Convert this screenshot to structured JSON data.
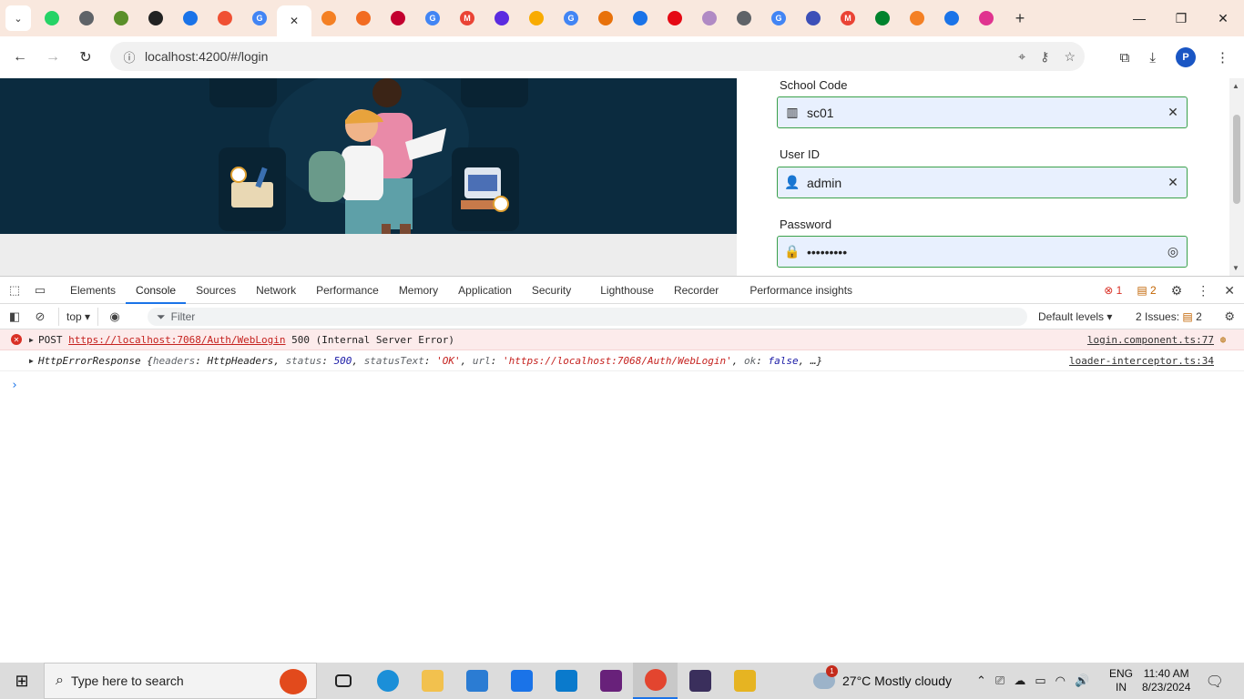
{
  "browser": {
    "tabs": [
      {
        "icon": "whatsapp-icon",
        "color": "#25d366",
        "glyph": ""
      },
      {
        "icon": "globe-icon",
        "color": "#5f6368",
        "glyph": ""
      },
      {
        "icon": "app-icon",
        "color": "#5a8f29",
        "glyph": ""
      },
      {
        "icon": "github-icon",
        "color": "#222222",
        "glyph": ""
      },
      {
        "icon": "chrome-settings-icon",
        "color": "#1a73e8",
        "glyph": ""
      },
      {
        "icon": "git-icon",
        "color": "#f05033",
        "glyph": ""
      },
      {
        "icon": "google-icon",
        "color": "#4285f4",
        "glyph": "G"
      },
      {
        "icon": "postman-icon",
        "color": "#3d3db8",
        "glyph": ""
      },
      {
        "icon": "stackoverflow-icon",
        "color": "#f48024",
        "glyph": ""
      },
      {
        "icon": "swagger-icon",
        "color": "#f26b21",
        "glyph": ""
      },
      {
        "icon": "angular-icon",
        "color": "#c3002f",
        "glyph": ""
      },
      {
        "icon": "google-icon",
        "color": "#4285f4",
        "glyph": "G"
      },
      {
        "icon": "gmail-icon",
        "color": "#ea4335",
        "glyph": "M"
      },
      {
        "icon": "paytm-icon",
        "color": "#5b2be0",
        "glyph": ""
      },
      {
        "icon": "apps-icon",
        "color": "#f9ab00",
        "glyph": ""
      },
      {
        "icon": "google-icon",
        "color": "#4285f4",
        "glyph": "G"
      },
      {
        "icon": "tool-icon",
        "color": "#e8710a",
        "glyph": ""
      },
      {
        "icon": "chrome-settings-icon",
        "color": "#1a73e8",
        "glyph": ""
      },
      {
        "icon": "netflix-icon",
        "color": "#e50914",
        "glyph": ""
      },
      {
        "icon": "image-icon",
        "color": "#b08ac4",
        "glyph": ""
      },
      {
        "icon": "globe-icon",
        "color": "#5f6368",
        "glyph": ""
      },
      {
        "icon": "google-icon",
        "color": "#4285f4",
        "glyph": "G"
      },
      {
        "icon": "app-icon",
        "color": "#3c4fb8",
        "glyph": ""
      },
      {
        "icon": "gmail-icon",
        "color": "#ea4335",
        "glyph": "M"
      },
      {
        "icon": "meet-icon",
        "color": "#00832d",
        "glyph": ""
      },
      {
        "icon": "stackoverflow-icon",
        "color": "#f48024",
        "glyph": ""
      },
      {
        "icon": "download-icon",
        "color": "#1a73e8",
        "glyph": ""
      },
      {
        "icon": "app-icon",
        "color": "#e0338f",
        "glyph": ""
      }
    ],
    "active_tab_index": 7,
    "url": "localhost:4200/#/login",
    "profile_initial": "P"
  },
  "login": {
    "school_code_label": "School Code",
    "school_code_value": "sc01",
    "user_id_label": "User ID",
    "user_id_value": "admin",
    "password_label": "Password",
    "password_value": "•••••••••",
    "field_border_color": "#3aa14a",
    "field_bg_color": "#e8f0fe"
  },
  "devtools": {
    "tabs": [
      "Elements",
      "Console",
      "Sources",
      "Network",
      "Performance",
      "Memory",
      "Application",
      "Security",
      "Lighthouse",
      "Recorder",
      "Performance insights"
    ],
    "active_tab": "Console",
    "error_count": "1",
    "warning_count": "2",
    "context": "top",
    "filter_placeholder": "Filter",
    "levels": "Default levels",
    "issues_label": "2 Issues:",
    "issues_count": "2",
    "messages": [
      {
        "method": "POST",
        "url": "https://localhost:7068/Auth/WebLogin",
        "status": "500 (Internal Server Error)",
        "source": "login.component.ts:77"
      },
      {
        "type_name": "HttpErrorResponse",
        "headers_key": "headers",
        "headers_val": "HttpHeaders",
        "status_key": "status",
        "status_val": "500",
        "statustext_key": "statusText",
        "statustext_val": "'OK'",
        "url_key": "url",
        "url_val": "'https://localhost:7068/Auth/WebLogin'",
        "ok_key": "ok",
        "ok_val": "false",
        "ellipsis": "…}",
        "source": "loader-interceptor.ts:34"
      }
    ]
  },
  "taskbar": {
    "search_placeholder": "Type here to search",
    "weather_badge": "1",
    "weather": "27°C  Mostly cloudy",
    "lang_top": "ENG",
    "lang_bottom": "IN",
    "time": "11:40 AM",
    "date": "8/23/2024"
  }
}
